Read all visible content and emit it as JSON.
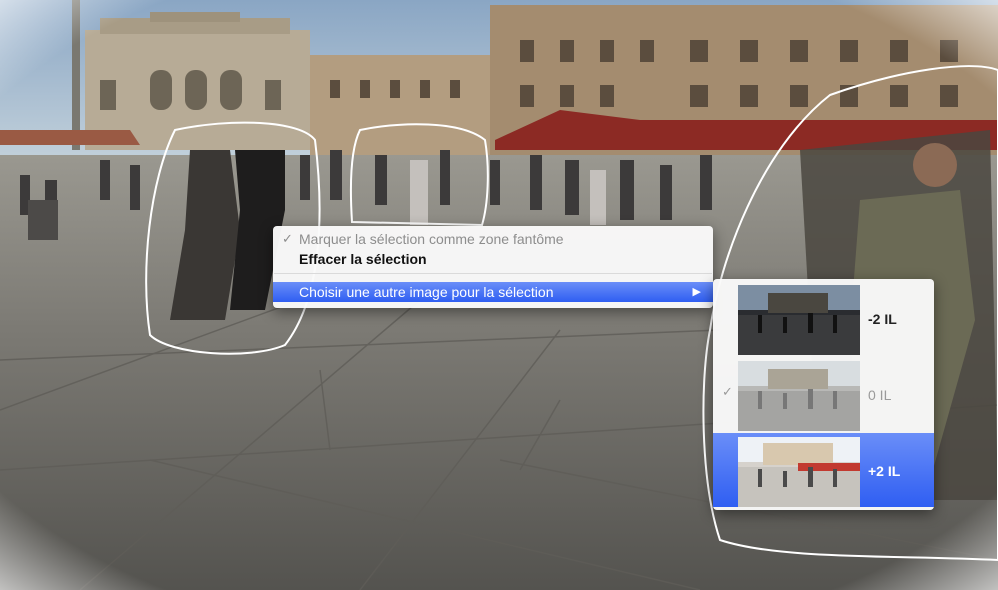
{
  "context_menu": {
    "items": [
      {
        "label": "Marquer la sélection comme zone fantôme",
        "check": "✓",
        "state": "disabled"
      },
      {
        "label": "Effacer la sélection",
        "state": "bold"
      },
      {
        "label": "Choisir une autre image pour la sélection",
        "arrow": "▶",
        "state": "highlighted"
      }
    ]
  },
  "submenu": {
    "items": [
      {
        "label": "-2 IL",
        "state": "normal",
        "thumbnail_icon": "dark-exposure-thumbnail"
      },
      {
        "label": "0 IL",
        "state": "dimmed-checked",
        "check": "✓",
        "thumbnail_icon": "normal-exposure-thumbnail"
      },
      {
        "label": "+2 IL",
        "state": "highlighted",
        "thumbnail_icon": "bright-exposure-thumbnail"
      }
    ]
  },
  "colors": {
    "menu_highlight": "#3c6cf4",
    "selection_outline": "#ffffff"
  }
}
